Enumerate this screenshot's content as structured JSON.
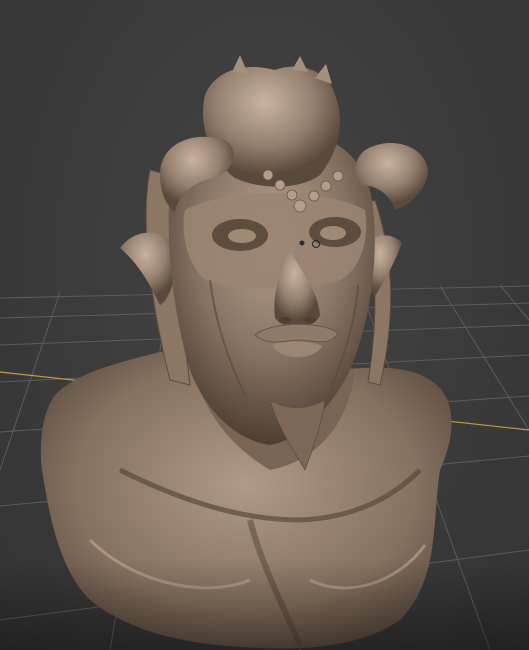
{
  "viewport": {
    "background_color": "#3a3a3a",
    "grid_color": "#5a5a5a",
    "axis_x_color": "#d9a640",
    "model_base_color": "#8a7565",
    "model_highlight_color": "#c7b09c",
    "model_shadow_color": "#4a3b30"
  },
  "scene": {
    "object": "sculpted-bust",
    "shading": "matcap-clay"
  }
}
